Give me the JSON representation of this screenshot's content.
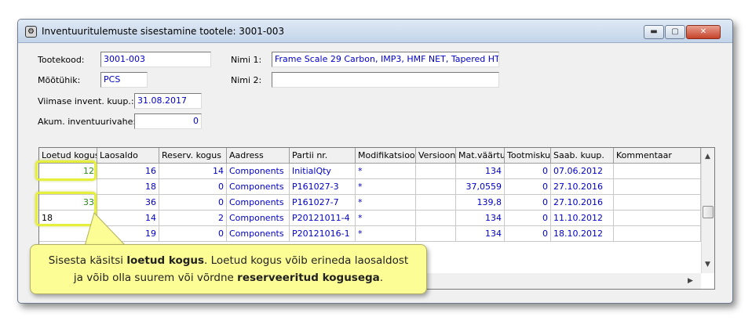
{
  "window": {
    "title": "Inventuuritulemuste sisestamine tootele: 3001-003",
    "controls": {
      "minimize": "▬",
      "maximize": "▢",
      "close": "✕"
    }
  },
  "form": {
    "tootekood_label": "Tootekood:",
    "tootekood_value": "3001-003",
    "nimi1_label": "Nimi 1:",
    "nimi1_value": "Frame Scale 29 Carbon, IMP3, HMF NET, Tapered HT",
    "mootuhik_label": "Mõõtühik:",
    "mootuhik_value": "PCS",
    "nimi2_label": "Nimi 2:",
    "nimi2_value": "",
    "viimase_label": "Viimase invent. kuup.:",
    "viimase_value": "31.08.2017",
    "akum_label": "Akum. inventuurivahe:",
    "akum_value": "0"
  },
  "grid": {
    "headers": [
      "Loetud kogus",
      "Laosaldo",
      "Reserv. kogus",
      "Aadress",
      "Partii nr.",
      "Modifikatsioon",
      "Versioon",
      "Mat.väärtus",
      "Tootmiskulu",
      "Saab. kuup.",
      "Kommentaar"
    ],
    "rows": [
      [
        "12",
        "16",
        "14",
        "Components",
        "InitialQty",
        "*",
        "",
        "134",
        "0",
        "07.06.2012",
        ""
      ],
      [
        "",
        "18",
        "0",
        "Components",
        "P161027-3",
        "*",
        "",
        "37,0559",
        "0",
        "27.10.2016",
        ""
      ],
      [
        "33",
        "36",
        "0",
        "Components",
        "P161027-7",
        "*",
        "",
        "139,8",
        "0",
        "27.10.2016",
        ""
      ],
      [
        "18",
        "14",
        "2",
        "Components",
        "P20121011-4",
        "*",
        "",
        "134",
        "0",
        "11.10.2012",
        ""
      ],
      [
        "",
        "19",
        "0",
        "Components",
        "P20121016-1",
        "*",
        "",
        "134",
        "0",
        "18.10.2012",
        ""
      ]
    ]
  },
  "callout": {
    "line1_a": "Sisesta käsitsi ",
    "line1_b": "loetud kogus",
    "line1_c": ". Loetud kogus võib erineda laosaldost",
    "line2_a": "ja võib olla suurem või võrdne ",
    "line2_b": "reserveeritud kogusega",
    "line2_c": "."
  },
  "icons": {
    "window": "gear-icon"
  },
  "colors": {
    "value_text": "#0000c8",
    "counted_text": "#2a8a1a",
    "highlight": "#e6ef3c",
    "callout_bg": "#fdfd96"
  }
}
